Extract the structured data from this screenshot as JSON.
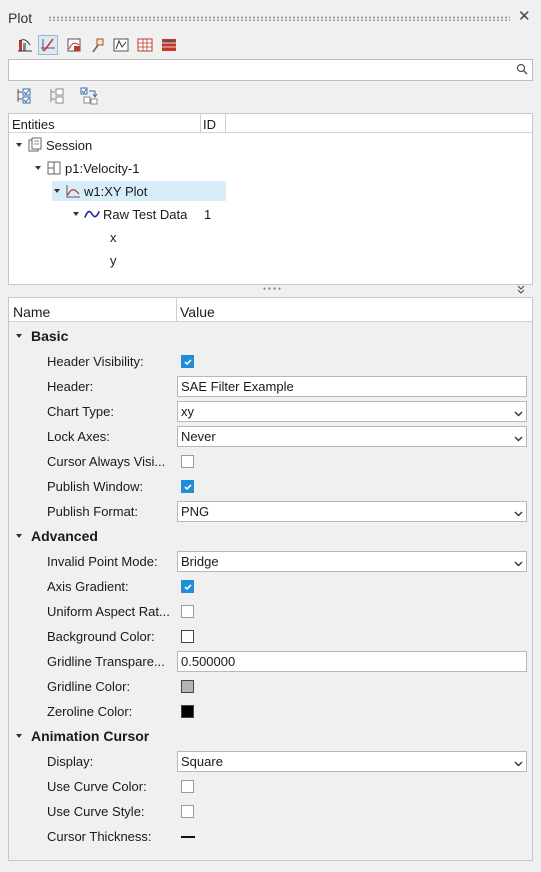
{
  "panel": {
    "title": "Plot",
    "close_glyph": "✕"
  },
  "toolbar": [
    {
      "icon": "plot-page-icon"
    },
    {
      "icon": "axis-plot-icon",
      "active": true
    },
    {
      "icon": "curve-page-icon"
    },
    {
      "icon": "pin-icon"
    },
    {
      "icon": "math-curve-icon"
    },
    {
      "icon": "grid-page-icon"
    },
    {
      "icon": "red-table-icon"
    }
  ],
  "search": {
    "value": "",
    "placeholder": ""
  },
  "tree": {
    "columns": {
      "entities": "Entities",
      "id": "ID"
    },
    "nodes": [
      {
        "label": "Session",
        "id": "",
        "icon": "session-icon",
        "expanded": true
      },
      {
        "label": "p1:Velocity-1",
        "id": "",
        "icon": "page-icon",
        "expanded": true
      },
      {
        "label": "w1:XY Plot",
        "id": "",
        "icon": "xy-plot-icon",
        "expanded": true,
        "selected": true
      },
      {
        "label": "Raw Test Data",
        "id": "1",
        "icon": "curve-icon",
        "expanded": true
      },
      {
        "label": "x",
        "id": ""
      },
      {
        "label": "y",
        "id": ""
      }
    ]
  },
  "properties": {
    "columns": {
      "name": "Name",
      "value": "Value"
    },
    "groups": {
      "basic": "Basic",
      "advanced": "Advanced",
      "animation_cursor": "Animation Cursor"
    },
    "rows": {
      "header_visibility": {
        "label": "Header Visibility:",
        "checked": true
      },
      "header": {
        "label": "Header:",
        "value": "SAE Filter Example"
      },
      "chart_type": {
        "label": "Chart Type:",
        "value": "xy"
      },
      "lock_axes": {
        "label": "Lock Axes:",
        "value": "Never"
      },
      "cursor_always_visible": {
        "label": "Cursor Always Visi...",
        "checked": false
      },
      "publish_window": {
        "label": "Publish Window:",
        "checked": true
      },
      "publish_format": {
        "label": "Publish Format:",
        "value": "PNG"
      },
      "invalid_point_mode": {
        "label": "Invalid Point Mode:",
        "value": "Bridge"
      },
      "axis_gradient": {
        "label": "Axis Gradient:",
        "checked": true
      },
      "uniform_aspect_ratio": {
        "label": "Uniform Aspect Rat...",
        "checked": false
      },
      "background_color": {
        "label": "Background Color:",
        "color": "#ffffff"
      },
      "gridline_transparency": {
        "label": "Gridline Transpare...",
        "value": "0.500000"
      },
      "gridline_color": {
        "label": "Gridline Color:",
        "color": "#b4b4b4"
      },
      "zeroline_color": {
        "label": "Zeroline Color:",
        "color": "#000000"
      },
      "display": {
        "label": "Display:",
        "value": "Square"
      },
      "use_curve_color": {
        "label": "Use Curve Color:",
        "checked": false
      },
      "use_curve_style": {
        "label": "Use Curve Style:",
        "checked": false
      },
      "cursor_thickness": {
        "label": "Cursor Thickness:"
      }
    }
  },
  "colors": {
    "accent": "#1e8fd6",
    "selection": "#d8edfa",
    "panel_bg": "#f0f0f0"
  }
}
